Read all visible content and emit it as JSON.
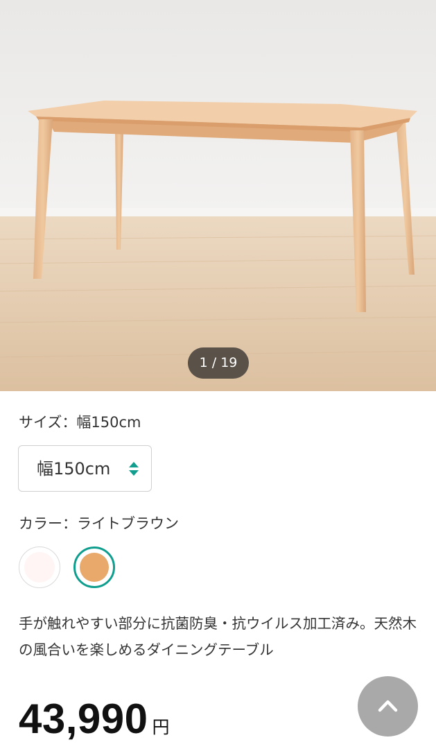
{
  "gallery": {
    "counter": "1 / 19"
  },
  "size": {
    "label": "サイズ：幅150cm",
    "selected": "幅150cm"
  },
  "color": {
    "label": "カラー：ライトブラウン",
    "options": [
      {
        "name": "white",
        "hex": "#fff5f4",
        "selected": false
      },
      {
        "name": "light-brown",
        "hex": "#e8a96a",
        "selected": true
      }
    ],
    "selected_border": "#0f9e8e"
  },
  "description": "手が触れやすい部分に抗菌防臭・抗ウイルス加工済み。天然木の風合いを楽しめるダイニングテーブル",
  "price": {
    "value": "43,990",
    "unit": "円"
  },
  "icons": {
    "size_select": "updown-arrows-icon",
    "scroll_top": "chevron-up-icon"
  }
}
